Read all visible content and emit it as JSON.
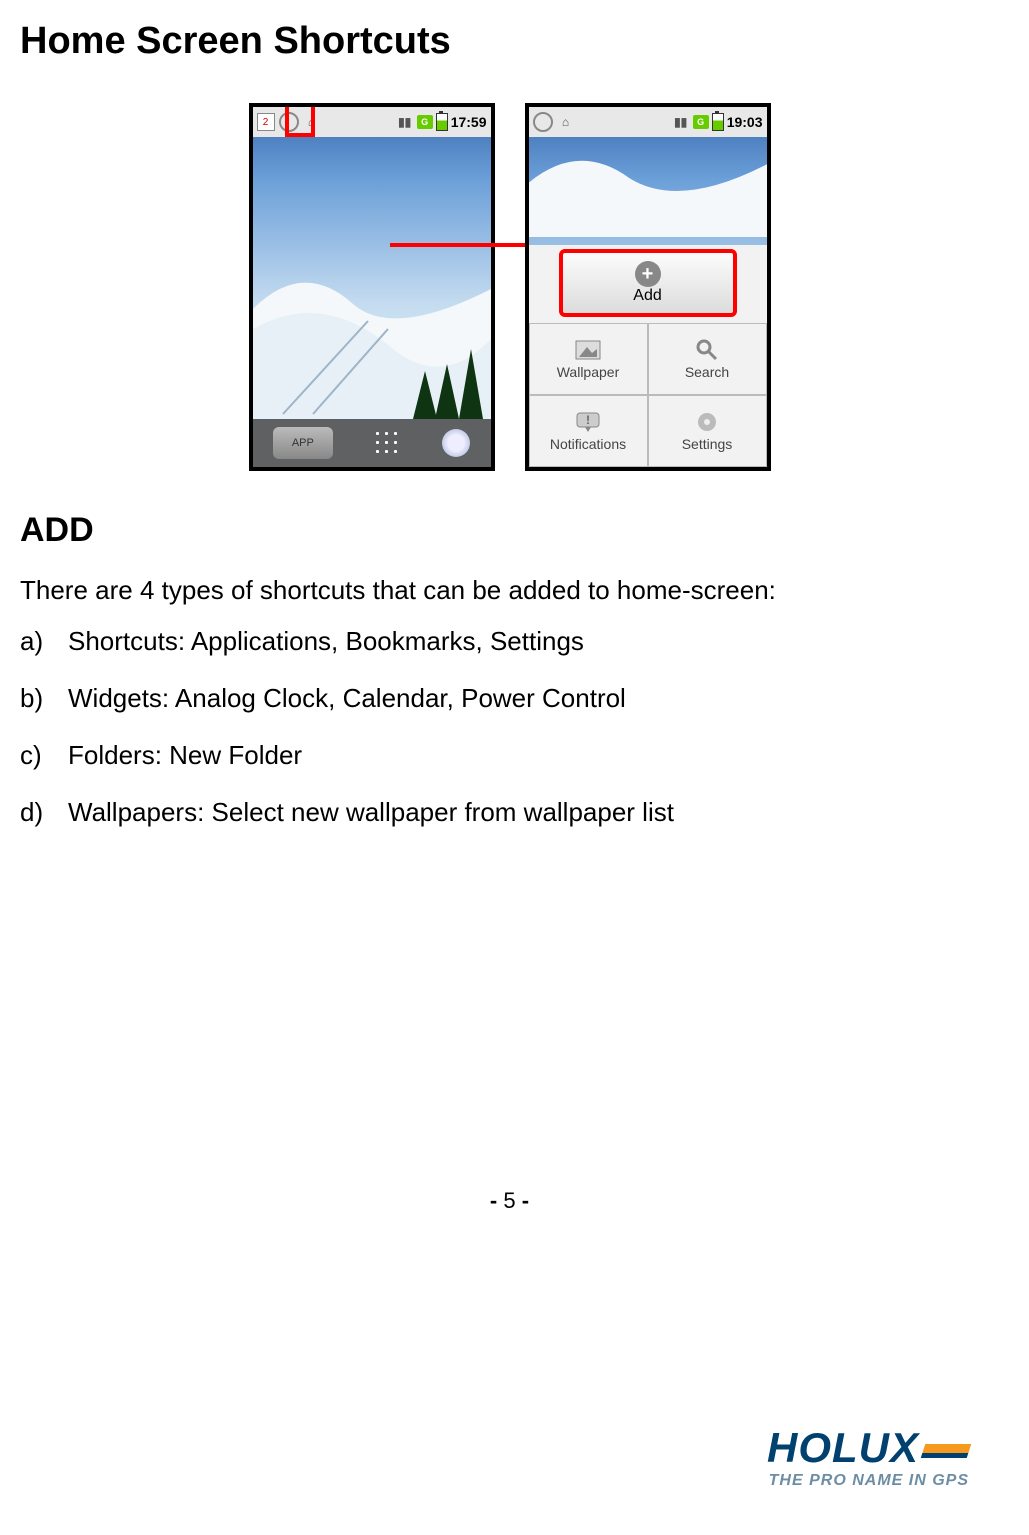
{
  "heading": "Home Screen Shortcuts",
  "phone1": {
    "time": "17:59",
    "dock_app": "APP"
  },
  "phone2": {
    "time": "19:03",
    "menu": {
      "add": "Add",
      "wallpaper": "Wallpaper",
      "search": "Search",
      "notifications": "Notifications",
      "settings": "Settings"
    }
  },
  "subheading": "ADD",
  "intro": "There are 4 types of shortcuts that can be added to home-screen:",
  "items": [
    {
      "marker": "a)",
      "text": "Shortcuts: Applications, Bookmarks, Settings"
    },
    {
      "marker": "b)",
      "text": "Widgets: Analog Clock, Calendar, Power Control"
    },
    {
      "marker": "c)",
      "text": "Folders: New Folder"
    },
    {
      "marker": "d)",
      "text": "Wallpapers: Select new wallpaper from wallpaper list"
    }
  ],
  "page": {
    "dash_l": "- ",
    "num": "5",
    "dash_r": " -"
  },
  "logo": {
    "name": "HOLUX",
    "tagline": "THE PRO NAME IN GPS"
  }
}
